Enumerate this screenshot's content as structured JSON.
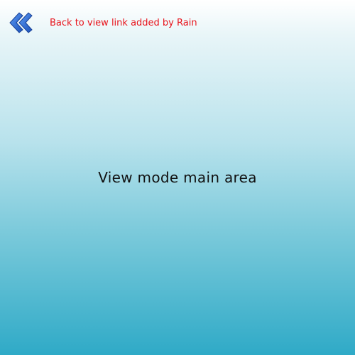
{
  "header": {
    "back_icon": "double-chevron-left-icon",
    "back_link_label": "Back to view link added by Rain"
  },
  "main": {
    "label": "View mode main area"
  },
  "colors": {
    "link": "#e8141c",
    "icon_dark": "#1a4fb8",
    "icon_light": "#4a8ef0",
    "background_top": "#ffffff",
    "background_bottom": "#2faac7"
  }
}
